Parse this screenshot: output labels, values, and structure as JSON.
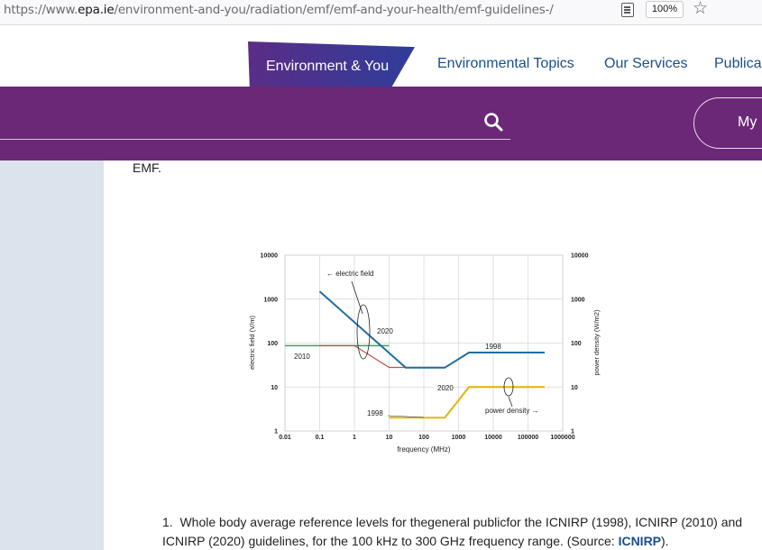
{
  "browser": {
    "url_prefix": "https://www.",
    "url_domain": "epa.ie",
    "url_path": "/environment-and-you/radiation/emf/emf-and-your-health/emf-guidelines-/",
    "zoom": "100%"
  },
  "nav": {
    "active": "Environment & You",
    "links": [
      "Environmental Topics",
      "Our Services",
      "Publica"
    ]
  },
  "header": {
    "my_button": "My I"
  },
  "content": {
    "intro_tail": "EMF.",
    "footnote_num": "1.",
    "footnote_text_1": "Whole body average reference levels for thegeneral publicfor the ICNIRP (1998), ICNIRP (2010) and",
    "footnote_text_2": "ICNIRP (2020) guidelines, for the 100 kHz to 300 GHz frequency range. (Source: ",
    "footnote_link": "ICNIRP",
    "footnote_end": ")."
  },
  "chart_data": {
    "type": "line",
    "xlabel": "frequency (MHz)",
    "ylabel": "electric field (V/m)",
    "y2label": "power density (W/m2)",
    "x_scale": "log",
    "y_scale": "log",
    "xlim": [
      0.01,
      1000000
    ],
    "ylim": [
      1,
      10000
    ],
    "x_ticks": [
      "0.01",
      "0.1",
      "1",
      "10",
      "100",
      "1000",
      "10000",
      "100000",
      "1000000"
    ],
    "y_ticks": [
      "1",
      "10",
      "100",
      "1000",
      "10000"
    ],
    "y2_ticks": [
      "1",
      "10",
      "100",
      "1000",
      "10000"
    ],
    "grid": true,
    "series": [
      {
        "name": "2010",
        "color": "#3aa06a",
        "x": [
          0.01,
          10
        ],
        "y": [
          87,
          87
        ]
      },
      {
        "name": "1998",
        "color": "#c0504d",
        "x": [
          0.1,
          1,
          10,
          400,
          2000,
          300000
        ],
        "y": [
          87,
          87,
          28,
          28,
          61,
          61
        ]
      },
      {
        "name": "2020",
        "color": "#1f6ea0",
        "x": [
          0.1,
          30,
          400,
          2000,
          300000
        ],
        "y": [
          1500,
          27.5,
          27.5,
          61,
          61
        ]
      },
      {
        "name": "1998",
        "color": "#e2b919",
        "x": [
          10,
          400,
          2000,
          300000
        ],
        "y": [
          2,
          2,
          10,
          10
        ]
      },
      {
        "name": "2020",
        "color": "#e2b919",
        "x": [
          400,
          2000,
          300000
        ],
        "y": [
          2,
          10,
          10
        ]
      }
    ],
    "annotations": [
      "← electric field",
      "2020",
      "2010",
      "1998",
      "2020",
      "1998",
      "power density →"
    ]
  }
}
